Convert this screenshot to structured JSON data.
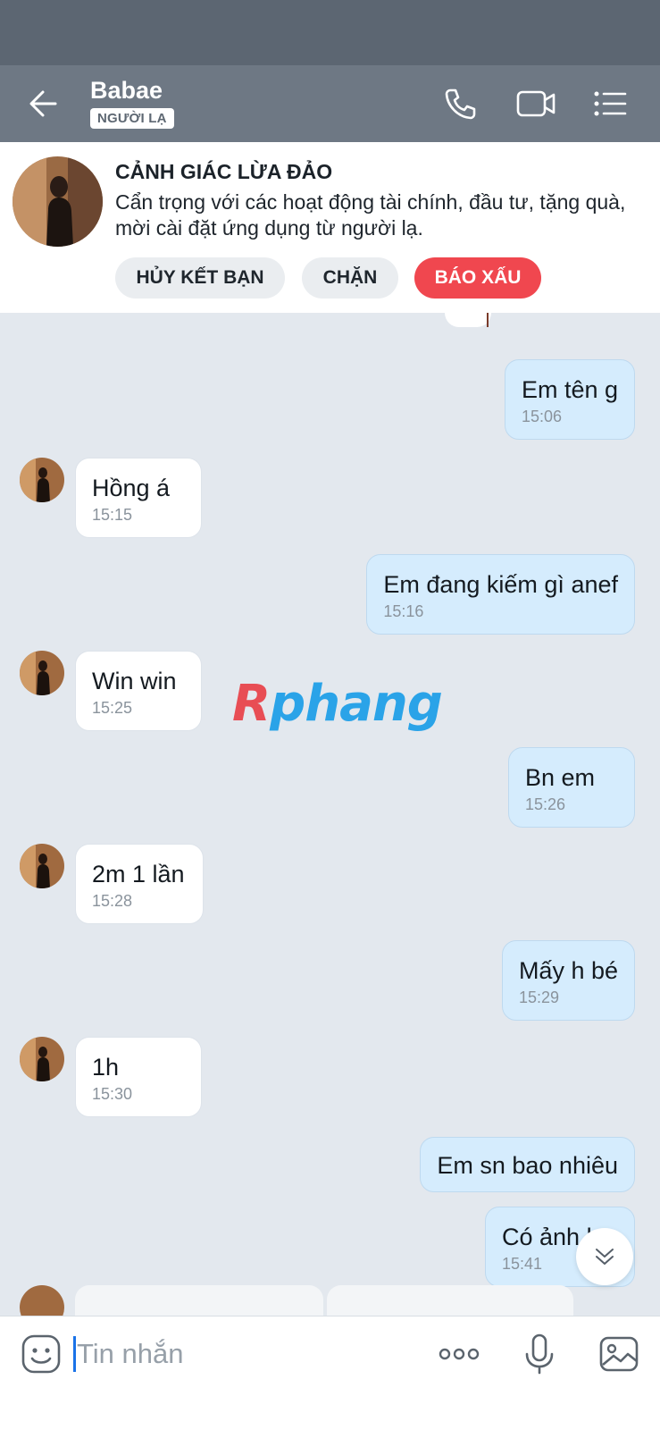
{
  "header": {
    "title": "Babae",
    "badge": "NGƯỜI LẠ",
    "icons": [
      "back-arrow-icon",
      "phone-icon",
      "video-call-icon",
      "menu-list-icon"
    ]
  },
  "warning": {
    "title": "CẢNH GIÁC LỪA ĐẢO",
    "text": "Cẩn trọng với các hoạt động tài chính, đầu tư, tặng quà, mời cài đặt ứng dụng từ người lạ.",
    "buttons": {
      "unfriend": "HỦY KẾT BẠN",
      "block": "CHẶN",
      "report": "BÁO XẤU"
    }
  },
  "messages": [
    {
      "dir": "out",
      "text": "Em tên g",
      "time": "15:06"
    },
    {
      "dir": "in",
      "text": "Hồng á",
      "time": "15:15"
    },
    {
      "dir": "out",
      "text": "Em đang kiếm gì anef",
      "time": "15:16"
    },
    {
      "dir": "in",
      "text": "Win win",
      "time": "15:25"
    },
    {
      "dir": "out",
      "text": "Bn em",
      "time": "15:26"
    },
    {
      "dir": "in",
      "text": "2m 1 lần",
      "time": "15:28"
    },
    {
      "dir": "out",
      "text": "Mấy h bé",
      "time": "15:29"
    },
    {
      "dir": "in",
      "text": "1h",
      "time": "15:30"
    },
    {
      "dir": "out",
      "text": "Em sn bao nhiêu",
      "time": ""
    },
    {
      "dir": "out",
      "text": "Có ảnh k",
      "time": "15:41"
    }
  ],
  "watermark": {
    "first": "R",
    "rest": "phang"
  },
  "input": {
    "placeholder": "Tin nhắn",
    "icons": [
      "emoji-sticker-icon",
      "more-dots-icon",
      "microphone-icon",
      "image-gallery-icon"
    ]
  },
  "colors": {
    "header_bg": "#6e7884",
    "outgoing_bubble": "#d5ecfd",
    "incoming_bubble": "#ffffff",
    "report_button": "#f0474f",
    "chat_bg": "#e3e8ee"
  }
}
